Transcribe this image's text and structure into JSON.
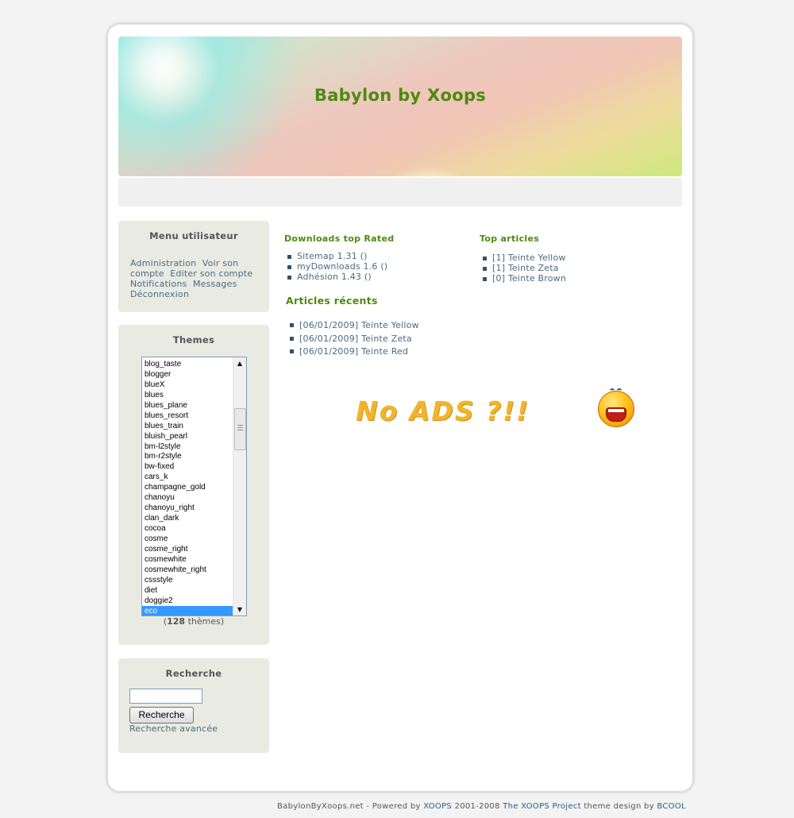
{
  "site": {
    "title": "Babylon by Xoops"
  },
  "user_menu": {
    "title": "Menu utilisateur",
    "links": [
      "Administration",
      "Voir son compte",
      "Editer son compte",
      "Notifications",
      "Messages",
      "Déconnexion"
    ]
  },
  "themes_block": {
    "title": "Themes",
    "items": [
      "blog_taste",
      "blogger",
      "blueX",
      "blues",
      "blues_plane",
      "blues_resort",
      "blues_train",
      "bluish_pearl",
      "bm-l2style",
      "bm-r2style",
      "bw-fixed",
      "cars_k",
      "champagne_gold",
      "chanoyu",
      "chanoyu_right",
      "clan_dark",
      "cocoa",
      "cosme",
      "cosme_right",
      "cosmewhite",
      "cosmewhite_right",
      "cssstyle",
      "diet",
      "doggie2",
      "eco"
    ],
    "selected": "eco",
    "count_open": "(",
    "count": "128",
    "count_close": " thèmes)"
  },
  "search_block": {
    "title": "Recherche",
    "input_value": "",
    "button_label": "Recherche",
    "advanced_link": "Recherche avancée"
  },
  "downloads": {
    "title": "Downloads top Rated",
    "items": [
      "Sitemap 1.31 ()",
      "myDownloads 1.6 ()",
      "Adhésion 1.43 ()"
    ]
  },
  "top_articles": {
    "title": "Top articles",
    "items": [
      "[1] Teinte Yellow",
      "[1] Teinte Zeta",
      "[0] Teinte Brown"
    ]
  },
  "recent_articles": {
    "title": "Articles récents",
    "items": [
      "[06/01/2009] Teinte Yellow",
      "[06/01/2009] Teinte Zeta",
      "[06/01/2009] Teinte Red"
    ]
  },
  "ad": {
    "text": "No ADS ?!!",
    "icon": "shouting-smiley-icon"
  },
  "footer": {
    "part1": "BabylonByXoops.net - Powered by ",
    "xoops": "XOOPS",
    "part2": " 2001-2008 ",
    "project": "The XOOPS Project",
    "part3": " theme design by ",
    "bcool": "BCOOL"
  },
  "colors": {
    "accent_green": "#4e8a10",
    "link_blue": "#4b6a80",
    "block_bg": "#e9ebe3",
    "selected": "#3399ff"
  }
}
